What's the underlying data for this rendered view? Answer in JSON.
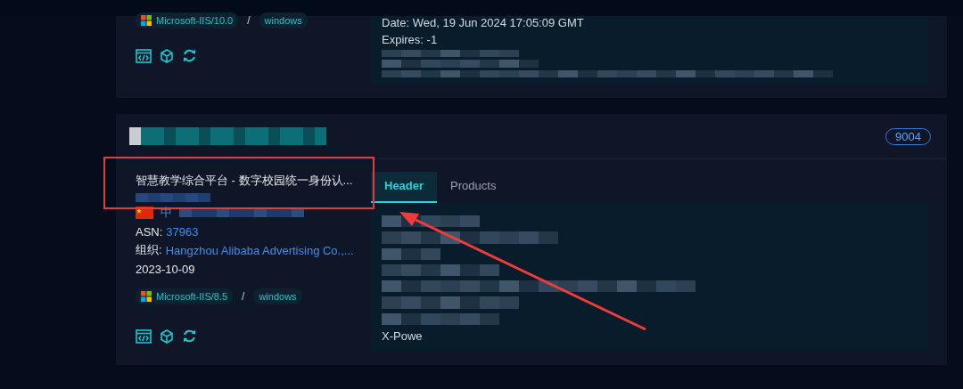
{
  "cards": [
    {
      "server": "Microsoft-IIS/10.0",
      "separator": "/",
      "os": "windows",
      "header_lines": [
        {
          "kind": "text",
          "text": "Date: Wed, 19 Jun 2024 17:05:09 GMT"
        },
        {
          "kind": "text",
          "text": "Expires: -1"
        },
        {
          "kind": "redacted"
        },
        {
          "kind": "redacted"
        },
        {
          "kind": "redacted"
        }
      ]
    },
    {
      "title": "智慧教学综合平台 - 数字校园统一身份认...",
      "port": "9004",
      "flag": true,
      "location": "中",
      "asn": {
        "label": "ASN:",
        "value": "37963"
      },
      "org": {
        "label": "组织:",
        "value": "Hangzhou Alibaba Advertising Co.,..."
      },
      "date": "2023-10-09",
      "server": "Microsoft-IIS/8.5",
      "separator": "/",
      "os": "windows",
      "tabs": [
        {
          "label": "Header",
          "selected": true
        },
        {
          "label": "Products",
          "selected": false
        }
      ],
      "header_lines": [
        {
          "kind": "redacted"
        },
        {
          "kind": "redacted"
        },
        {
          "kind": "redacted"
        },
        {
          "kind": "redacted"
        },
        {
          "kind": "redacted"
        },
        {
          "kind": "redacted"
        },
        {
          "kind": "redacted"
        },
        {
          "kind": "text",
          "text": "X-Powe"
        }
      ]
    }
  ]
}
